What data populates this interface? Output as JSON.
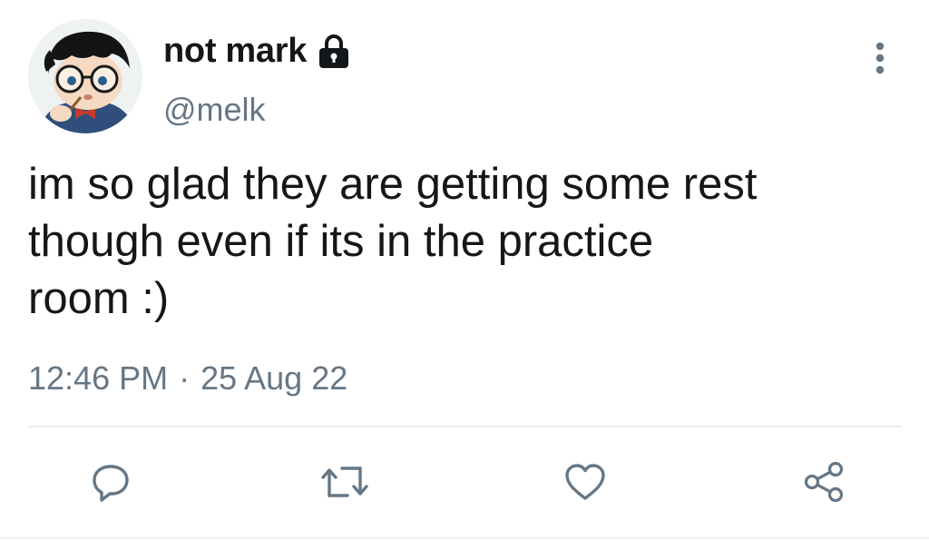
{
  "tweet": {
    "author": {
      "display_name": "not mark",
      "handle": "@melk",
      "protected": true,
      "avatar_icon": "anime-boy-glasses-avatar"
    },
    "text": "im so glad they are getting some rest\nthough even if its in the practice\nroom :)",
    "time": "12:46 PM",
    "separator": "·",
    "date": "25 Aug 22"
  },
  "actions": [
    {
      "name": "reply",
      "icon": "speech-bubble-icon"
    },
    {
      "name": "retweet",
      "icon": "retweet-arrows-icon"
    },
    {
      "name": "like",
      "icon": "heart-icon"
    },
    {
      "name": "share",
      "icon": "share-nodes-icon"
    }
  ],
  "colors": {
    "text": "#14171a",
    "secondary": "#657786",
    "icon": "#657786",
    "divider": "#e6ecf0"
  }
}
